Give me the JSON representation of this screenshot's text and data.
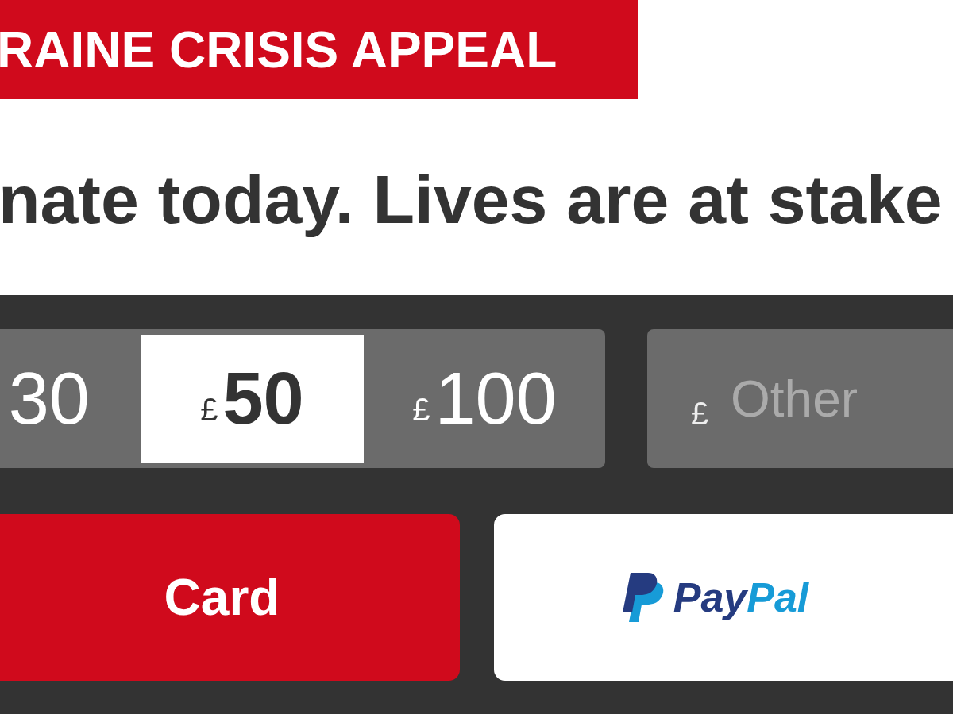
{
  "banner": {
    "title": "RAINE CRISIS APPEAL"
  },
  "headline": "nate today. Lives are at stake",
  "amounts": [
    {
      "amount": "30",
      "selected": false
    },
    {
      "currency": "£",
      "amount": "50",
      "selected": true
    },
    {
      "currency": "£",
      "amount": "100",
      "selected": false
    }
  ],
  "other_amount": {
    "currency": "£",
    "placeholder": "Other"
  },
  "payment_buttons": [
    {
      "kind": "card",
      "label": "Card"
    },
    {
      "kind": "paypal",
      "label_1": "Pay",
      "label_2": "Pal"
    }
  ]
}
